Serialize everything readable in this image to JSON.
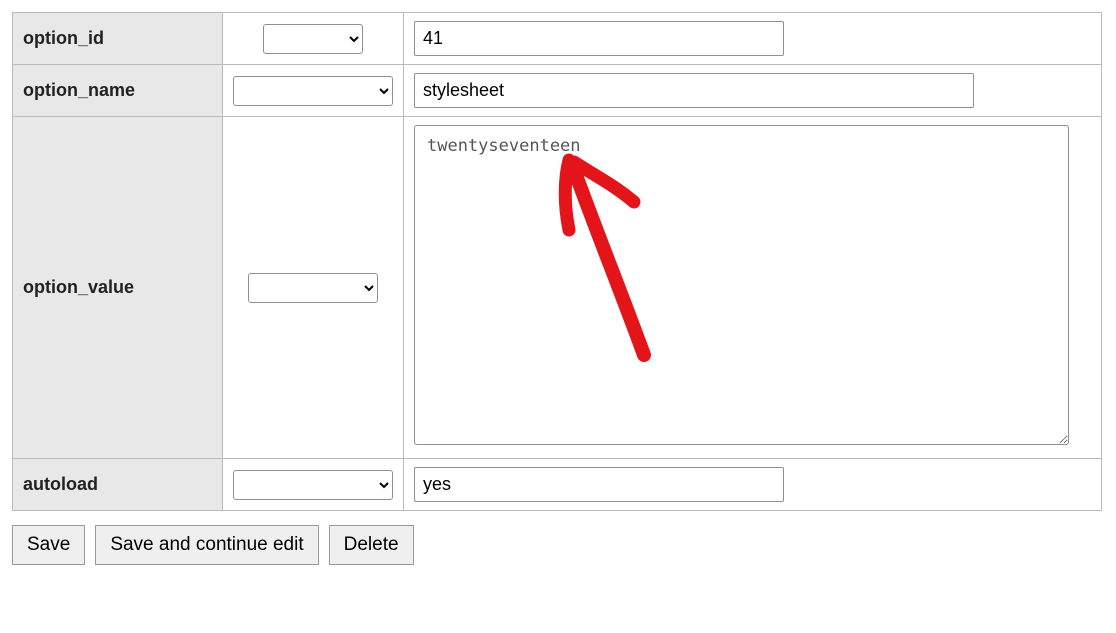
{
  "rows": {
    "option_id": {
      "label": "option_id",
      "value": "41"
    },
    "option_name": {
      "label": "option_name",
      "value": "stylesheet"
    },
    "option_value": {
      "label": "option_value",
      "value": "twentyseventeen"
    },
    "autoload": {
      "label": "autoload",
      "value": "yes"
    }
  },
  "buttons": {
    "save": "Save",
    "save_continue": "Save and continue edit",
    "delete": "Delete"
  }
}
